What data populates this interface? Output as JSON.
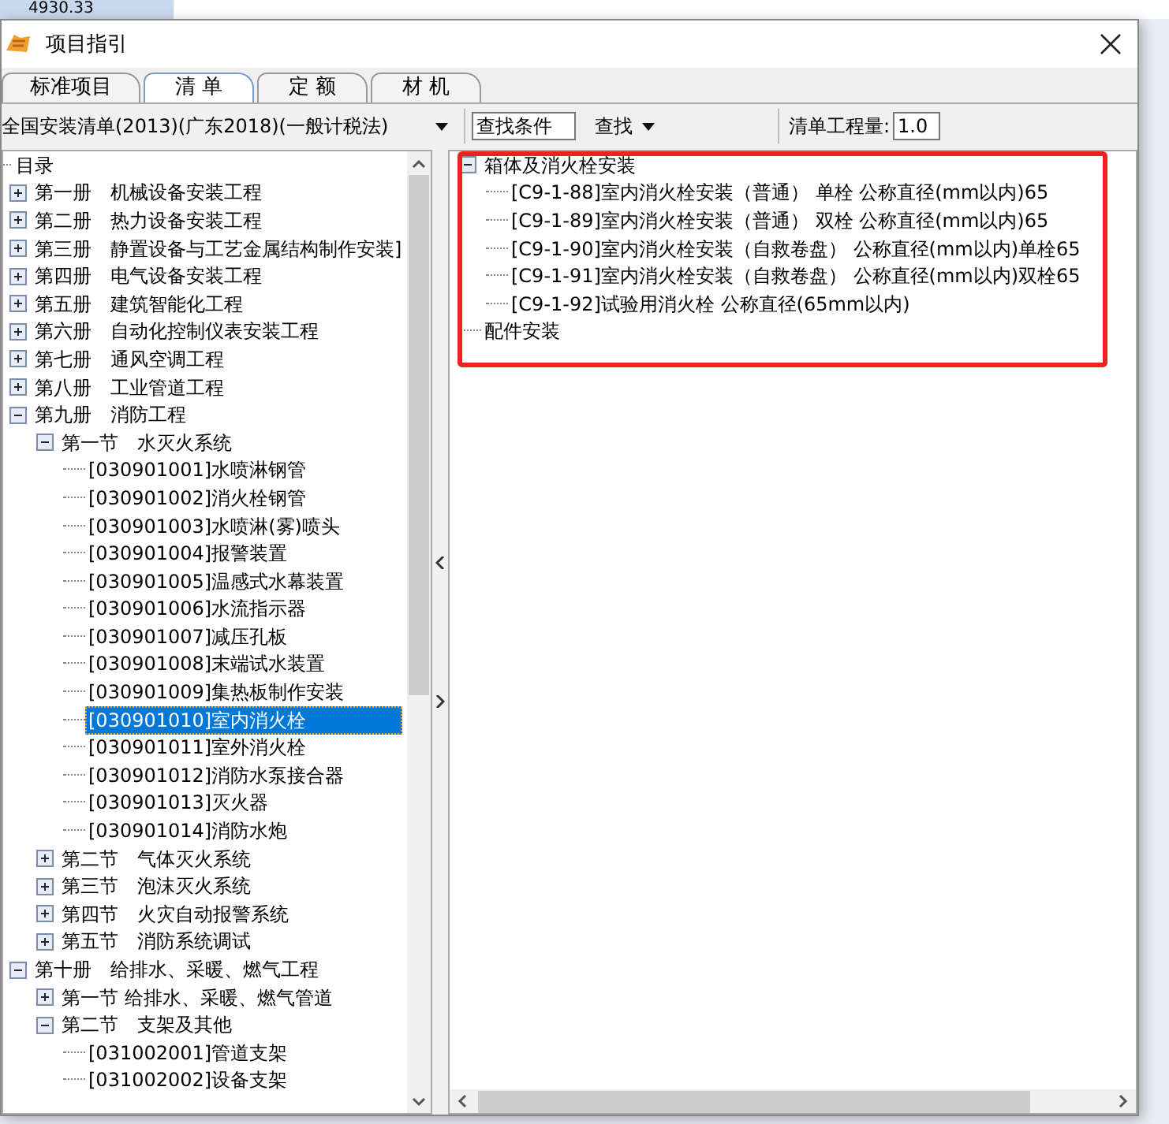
{
  "background": {
    "cell": "4930.33"
  },
  "window": {
    "title": "项目指引"
  },
  "tabs": [
    {
      "label": "标准项目",
      "selected": false
    },
    {
      "label": "清 单",
      "selected": true
    },
    {
      "label": "定 额",
      "selected": false
    },
    {
      "label": "材 机",
      "selected": false
    }
  ],
  "toolbar": {
    "library": "全国安装清单(2013)(广东2018)(一般计税法)",
    "search_field": {
      "value": "查找条件"
    },
    "find_button": "查找",
    "quantity_label": "清单工程量:",
    "quantity_field": {
      "value": "1.0"
    }
  },
  "catalog_tree": {
    "root": "目录",
    "children": [
      {
        "label": "第一册　机械设备安装工程",
        "expanded": false,
        "selected": false
      },
      {
        "label": "第二册　热力设备安装工程",
        "expanded": false,
        "selected": false
      },
      {
        "label": "第三册　静置设备与工艺金属结构制作安装]",
        "expanded": false,
        "selected": false
      },
      {
        "label": "第四册　电气设备安装工程",
        "expanded": false,
        "selected": false
      },
      {
        "label": "第五册　建筑智能化工程",
        "expanded": false,
        "selected": false
      },
      {
        "label": "第六册　自动化控制仪表安装工程",
        "expanded": false,
        "selected": false
      },
      {
        "label": "第七册　通风空调工程",
        "expanded": false,
        "selected": false
      },
      {
        "label": "第八册　工业管道工程",
        "expanded": false,
        "selected": false
      },
      {
        "label": "第九册　消防工程",
        "expanded": true,
        "selected": false,
        "children": [
          {
            "label": "第一节　水灭火系统",
            "expanded": true,
            "selected": false,
            "children": [
              {
                "label": "[030901001]水喷淋钢管",
                "selected": false
              },
              {
                "label": "[030901002]消火栓钢管",
                "selected": false
              },
              {
                "label": "[030901003]水喷淋(雾)喷头",
                "selected": false
              },
              {
                "label": "[030901004]报警装置",
                "selected": false
              },
              {
                "label": "[030901005]温感式水幕装置",
                "selected": false
              },
              {
                "label": "[030901006]水流指示器",
                "selected": false
              },
              {
                "label": "[030901007]减压孔板",
                "selected": false
              },
              {
                "label": "[030901008]末端试水装置",
                "selected": false
              },
              {
                "label": "[030901009]集热板制作安装",
                "selected": false
              },
              {
                "label": "[030901010]室内消火栓",
                "selected": true
              },
              {
                "label": "[030901011]室外消火栓",
                "selected": false
              },
              {
                "label": "[030901012]消防水泵接合器",
                "selected": false
              },
              {
                "label": "[030901013]灭火器",
                "selected": false
              },
              {
                "label": "[030901014]消防水炮",
                "selected": false
              }
            ]
          },
          {
            "label": "第二节　气体灭火系统",
            "expanded": false,
            "selected": false
          },
          {
            "label": "第三节　泡沫灭火系统",
            "expanded": false,
            "selected": false
          },
          {
            "label": "第四节　火灾自动报警系统",
            "expanded": false,
            "selected": false
          },
          {
            "label": "第五节　消防系统调试",
            "expanded": false,
            "selected": false
          }
        ]
      },
      {
        "label": "第十册　给排水、采暖、燃气工程",
        "expanded": true,
        "selected": false,
        "children": [
          {
            "label": "第一节 给排水、采暖、燃气管道",
            "expanded": false,
            "selected": false
          },
          {
            "label": "第二节　支架及其他",
            "expanded": true,
            "selected": false,
            "children": [
              {
                "label": "[031002001]管道支架",
                "selected": false
              },
              {
                "label": "[031002002]设备支架",
                "selected": false
              }
            ]
          }
        ]
      }
    ]
  },
  "quota_tree": {
    "children": [
      {
        "label": "箱体及消火栓安装",
        "expanded": true,
        "selected": false,
        "children": [
          {
            "label": "[C9-1-88]室内消火栓安装（普通） 单栓 公称直径(mm以内)65",
            "selected": false
          },
          {
            "label": "[C9-1-89]室内消火栓安装（普通） 双栓 公称直径(mm以内)65",
            "selected": false
          },
          {
            "label": "[C9-1-90]室内消火栓安装（自救卷盘） 公称直径(mm以内)单栓65",
            "selected": false
          },
          {
            "label": "[C9-1-91]室内消火栓安装（自救卷盘） 公称直径(mm以内)双栓65",
            "selected": false
          },
          {
            "label": "[C9-1-92]试验用消火栓 公称直径(65mm以内)",
            "selected": false
          }
        ]
      },
      {
        "label": "配件安装",
        "selected": false
      }
    ]
  }
}
